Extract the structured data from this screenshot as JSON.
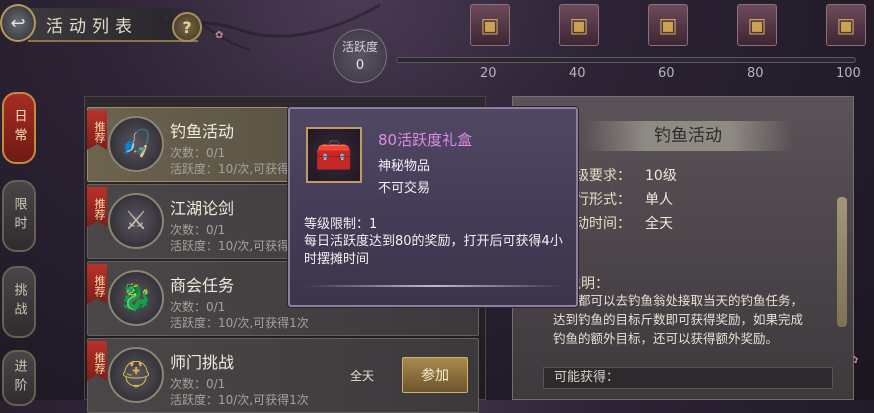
{
  "header": {
    "back_icon": "back-arrow-icon",
    "title": "活动列表",
    "help_label": "?"
  },
  "activity": {
    "label": "活跃度",
    "value": "0",
    "progress_fraction": 0,
    "milestones": [
      "20",
      "40",
      "60",
      "80",
      "100"
    ],
    "chest_icon": "treasure-chest-icon"
  },
  "tabs": [
    {
      "label": "日常",
      "active": true
    },
    {
      "label": "限时",
      "active": false
    },
    {
      "label": "挑战",
      "active": false
    },
    {
      "label": "进阶",
      "active": false
    }
  ],
  "activities": [
    {
      "tag": "推荐",
      "name": "钓鱼活动",
      "count": "次数：0/1",
      "activeness": "活跃度：10/次,可获得",
      "icon": "fishing-icon"
    },
    {
      "tag": "推荐",
      "name": "江湖论剑",
      "count": "次数：0/1",
      "activeness": "活跃度：10/次,可获得",
      "icon": "crossed-swords-icon"
    },
    {
      "tag": "推荐",
      "name": "商会任务",
      "count": "次数：0/1",
      "activeness": "活跃度：10/次,可获得1次",
      "icon": "dragon-icon"
    },
    {
      "tag": "推荐",
      "name": "师门挑战",
      "count": "次数：0/1",
      "activeness": "活跃度：10/次,可获得1次",
      "icon": "gold-helmet-icon",
      "time": "全天",
      "join_label": "参加"
    }
  ],
  "detail": {
    "title": "钓鱼活动",
    "level_label": "级要求：",
    "level_value": "10级",
    "form_label": "行形式：",
    "form_value": "单人",
    "time_label": "动时间：",
    "time_value": "全天",
    "desc_title": "动说明：",
    "description": "每天都可以去钓鱼翁处接取当天的钓鱼任务，达到钓鱼的目标斤数即可获得奖励，如果完成钓鱼的额外目标，还可以获得额外奖励。",
    "reward_label": "可能获得："
  },
  "tooltip": {
    "name": "80活跃度礼盒",
    "type": "神秘物品",
    "trade": "不可交易",
    "level": "等级限制：1",
    "description": "每日活跃度达到80的奖励，打开后可获得4小时摆摊时间",
    "icon": "treasure-chest-icon",
    "name_color": "#df8be8"
  }
}
